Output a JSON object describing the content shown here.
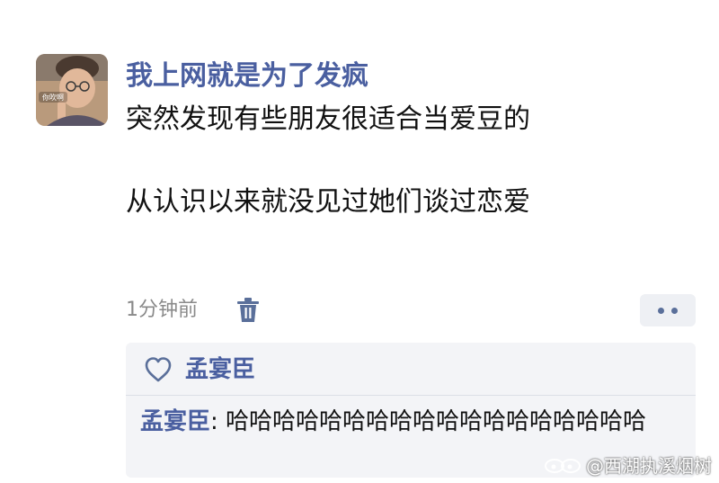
{
  "post": {
    "username": "我上网就是为了发疯",
    "avatar_label": "你吹啊",
    "lines": [
      "突然发现有些朋友很适合当爱豆的",
      "从认识以来就没见过她们谈过恋爱"
    ],
    "timestamp": "1分钟前"
  },
  "icons": {
    "delete": "trash-icon",
    "more": "more-dots-icon",
    "like": "heart-icon",
    "watermark": "weibo-logo-icon"
  },
  "interactions": {
    "liker": "孟宴臣",
    "comment_author": "孟宴臣",
    "comment_separator": ": ",
    "comment_text": "哈哈哈哈哈哈哈哈哈哈哈哈哈哈哈哈哈哈"
  },
  "watermark": {
    "text": "@西湖执溪烟树"
  },
  "colors": {
    "username": "#4a5fa0",
    "text": "#111111",
    "muted": "#8a8a8a",
    "panel_bg": "#f3f4f7"
  }
}
